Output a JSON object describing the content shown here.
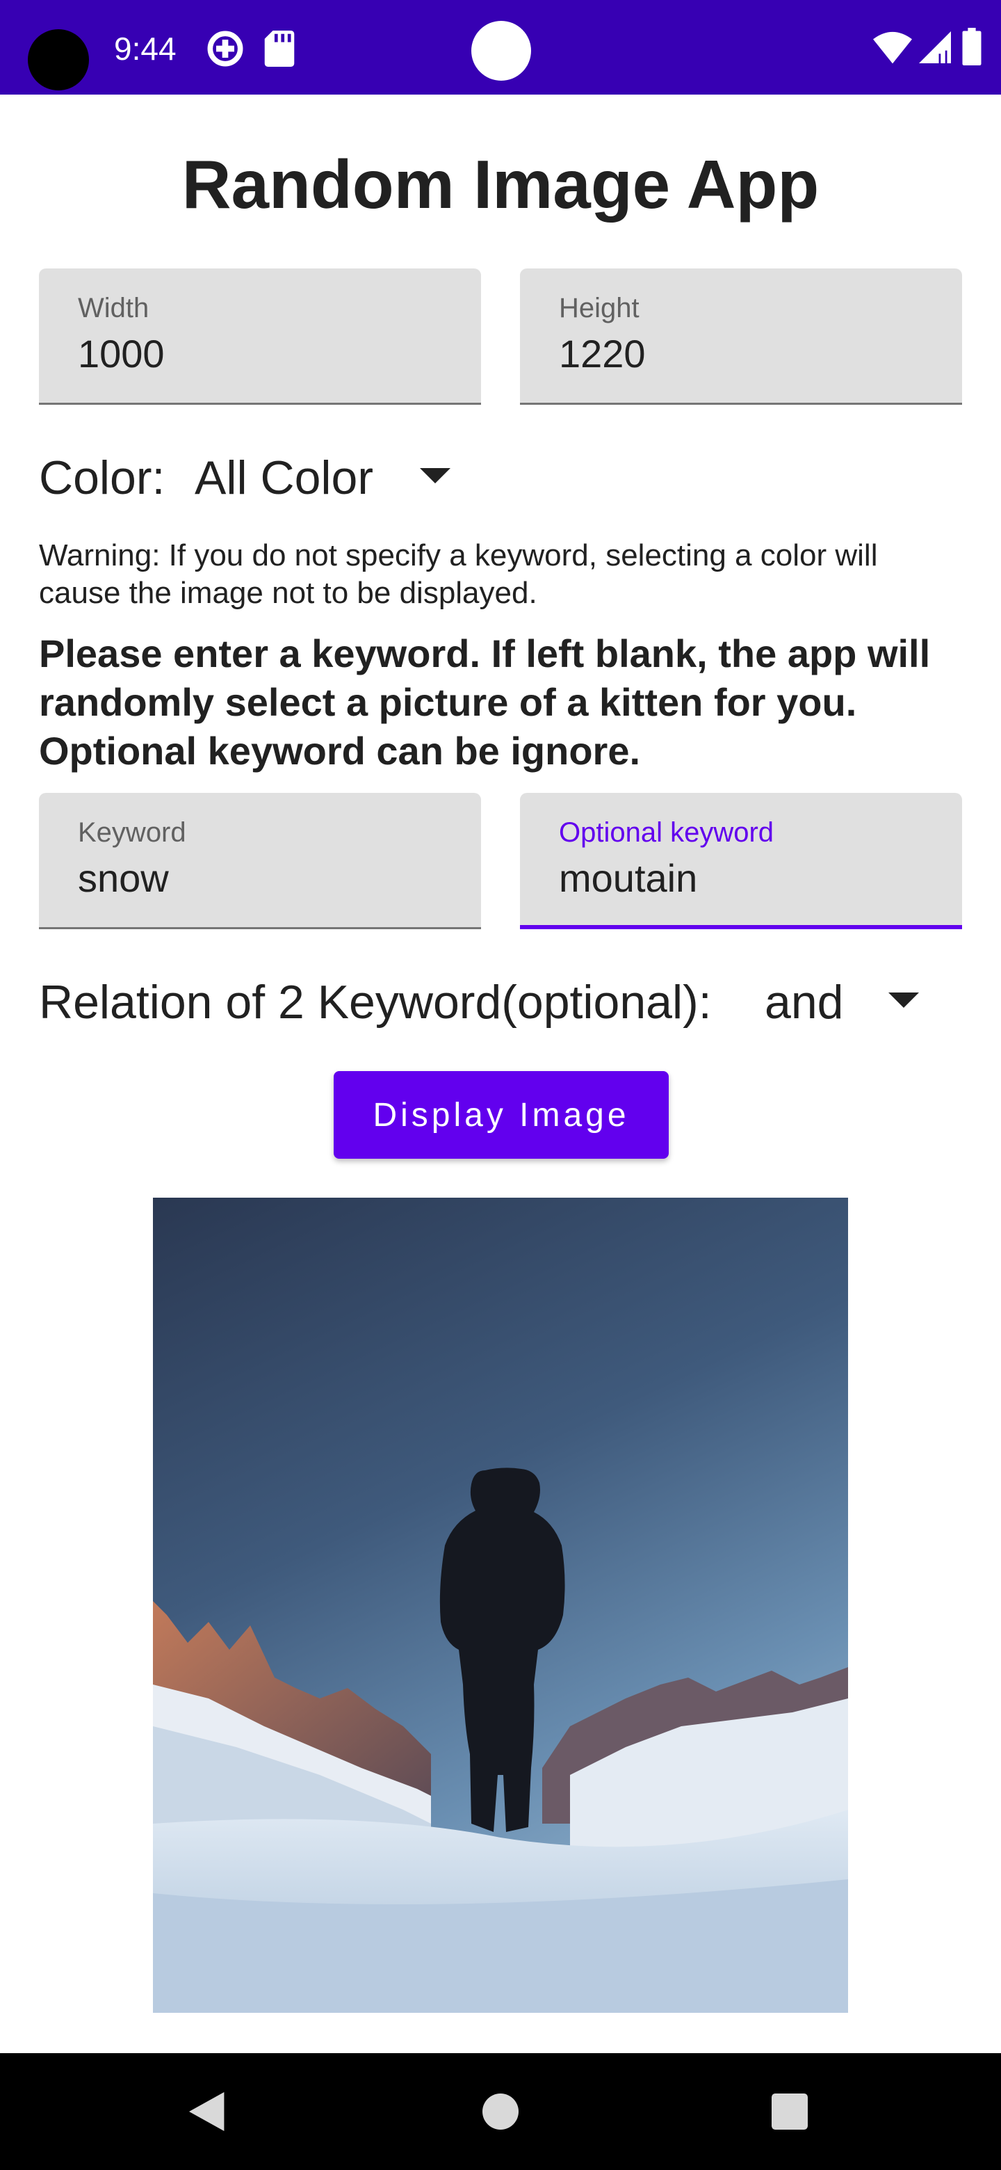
{
  "status_bar": {
    "time": "9:44",
    "icons": [
      "camera-hole",
      "data-saver-icon",
      "sd-card-icon",
      "wifi-icon",
      "cellular-signal-icon",
      "battery-icon"
    ]
  },
  "app": {
    "title": "Random Image App"
  },
  "width_field": {
    "label": "Width",
    "value": "1000"
  },
  "height_field": {
    "label": "Height",
    "value": "1220"
  },
  "color": {
    "label": "Color:",
    "selected": "All Color"
  },
  "warning": "Warning: If you do not specify a keyword, selecting a color will cause the image not to be displayed.",
  "instruction": "Please enter a keyword. If left blank, the app will randomly select a picture of a kitten for you. Optional keyword can be ignore.",
  "keyword_field": {
    "label": "Keyword",
    "value": "snow"
  },
  "optional_keyword_field": {
    "label": "Optional keyword",
    "value": "moutain"
  },
  "relation": {
    "label": "Relation of 2 Keyword(optional):",
    "selected": "and"
  },
  "display_button": {
    "label": "Display Image"
  },
  "colors": {
    "status_bar": "#3700b3",
    "accent": "#6200ee",
    "field_bg": "#e0e0e0",
    "nav_bar": "#000000"
  },
  "nav_bar": {
    "icons": [
      "back-icon",
      "home-icon",
      "recents-icon"
    ]
  }
}
